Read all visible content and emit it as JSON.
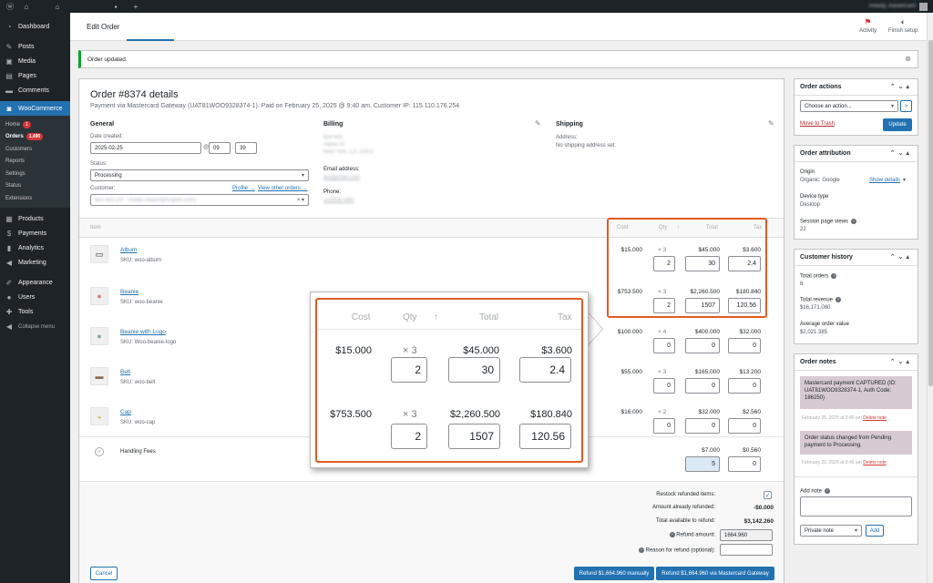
{
  "admin_bar": {
    "greeting": "Howdy, mastercard"
  },
  "sidebar": {
    "items": [
      {
        "label": "Dashboard"
      },
      {
        "label": "Posts"
      },
      {
        "label": "Media"
      },
      {
        "label": "Pages"
      },
      {
        "label": "Comments"
      },
      {
        "label": "WooCommerce"
      }
    ],
    "woo_submenu": [
      {
        "label": "Home",
        "badge": "1"
      },
      {
        "label": "Orders",
        "badge": "1,496"
      },
      {
        "label": "Customers"
      },
      {
        "label": "Reports"
      },
      {
        "label": "Settings"
      },
      {
        "label": "Status"
      },
      {
        "label": "Extensions"
      }
    ],
    "items_after": [
      {
        "label": "Products"
      },
      {
        "label": "Payments"
      },
      {
        "label": "Analytics"
      },
      {
        "label": "Marketing"
      },
      {
        "label": "Appearance"
      },
      {
        "label": "Users"
      },
      {
        "label": "Tools"
      },
      {
        "label": "Collapse menu"
      }
    ]
  },
  "header": {
    "title": "Edit Order",
    "activity": "Activity",
    "finish_setup": "Finish setup"
  },
  "notice": {
    "text": "Order updated."
  },
  "order": {
    "title": "Order #8374 details",
    "subtitle": "Payment via Mastercard Gateway (UAT81WOO9328374-1). Paid on February 25, 2025 @ 9:40 am. Customer IP: 115.110.176.254",
    "general": {
      "heading": "General",
      "date_label": "Date created:",
      "date": "2025-02-25",
      "at": "@",
      "hour": "09",
      "colon": ":",
      "minute": "39",
      "status_label": "Status:",
      "status": "Processing",
      "customer_label": "Customer:",
      "profile_link": "Profile →",
      "other_orders_link": "View other orders →",
      "customer_value": "test test (#4 - mobia.shaikh@fingent.com)"
    },
    "billing": {
      "heading": "Billing",
      "address_lines": [
        "test test",
        "Alpha St",
        "New York, CA 10001"
      ],
      "email_label": "Email address:",
      "email": "test@mail.com",
      "phone_label": "Phone:",
      "phone": "1234567890"
    },
    "shipping": {
      "heading": "Shipping",
      "address_label": "Address:",
      "address": "No shipping address set."
    }
  },
  "items_table": {
    "headers": {
      "item": "Item",
      "cost": "Cost",
      "qty": "Qty",
      "sort": "↑",
      "total": "Total",
      "tax": "Tax"
    },
    "rows": [
      {
        "name": "Album",
        "sku": "SKU: woo-album",
        "icon": "album-icon",
        "cost": "$15.000",
        "qty": "× 3",
        "total": "$45.000",
        "tax": "$3.600",
        "refund_qty": "2",
        "refund_total": "30",
        "refund_tax": "2.4"
      },
      {
        "name": "Beanie",
        "sku": "SKU: woo-beanie",
        "icon": "beanie-icon",
        "cost": "$753.500",
        "qty": "× 3",
        "total": "$2,260.500",
        "tax": "$180.840",
        "refund_qty": "2",
        "refund_total": "1507",
        "refund_tax": "120.56"
      },
      {
        "name": "Beanie with Logo",
        "sku": "SKU: Woo-beanie-logo",
        "icon": "beanie-logo-icon",
        "cost": "$100.000",
        "qty": "× 4",
        "total": "$400.000",
        "tax": "$32.000",
        "refund_qty": "0",
        "refund_total": "0",
        "refund_tax": "0"
      },
      {
        "name": "Belt",
        "sku": "SKU: woo-belt",
        "icon": "belt-icon",
        "cost": "$55.000",
        "qty": "× 3",
        "total": "$165.000",
        "tax": "$13.200",
        "refund_qty": "0",
        "refund_total": "0",
        "refund_tax": "0"
      },
      {
        "name": "Cap",
        "sku": "SKU: woo-cap",
        "icon": "cap-icon",
        "cost": "$16.000",
        "qty": "× 2",
        "total": "$32.000",
        "tax": "$2.560",
        "refund_qty": "0",
        "refund_total": "0",
        "refund_tax": "0"
      }
    ],
    "fee": {
      "name": "Handling Fees",
      "total": "$7.000",
      "tax": "$0.560",
      "refund_total": "5",
      "refund_tax": "0"
    }
  },
  "refund": {
    "restock_label": "Restock refunded items:",
    "already_label": "Amount already refunded:",
    "already_value": "-$0.000",
    "available_label": "Total available to refund:",
    "available_value": "$3,142.260",
    "amount_label": "Refund amount:",
    "amount_value": "1664.960",
    "reason_label": "Reason for refund (optional):",
    "reason_value": "",
    "cancel": "Cancel",
    "manual": "Refund $1,664.960 manually",
    "gateway": "Refund $1,664.960 via Mastercard Gateway"
  },
  "order_actions": {
    "title": "Order actions",
    "select": "Choose an action...",
    "go": ">",
    "trash": "Move to Trash",
    "update": "Update"
  },
  "attribution": {
    "title": "Order attribution",
    "origin_label": "Origin",
    "origin_value": "Organic: Google",
    "show_details": "Show details",
    "device_label": "Device type",
    "device_value": "Desktop",
    "views_label": "Session page views",
    "views_value": "22"
  },
  "customer_history": {
    "title": "Customer history",
    "total_orders_label": "Total orders",
    "total_orders_value": "8",
    "revenue_label": "Total revenue",
    "revenue_value": "$16,171.080",
    "avg_label": "Average order value",
    "avg_value": "$2,021.385"
  },
  "order_notes": {
    "title": "Order notes",
    "notes": [
      {
        "text": "Mastercard payment CAPTURED (ID: UAT81WOO9328374-1, Auth Code: 186250)",
        "meta": "February 25, 2025 at 9:40 am",
        "delete": "Delete note"
      },
      {
        "text": "Order status changed from Pending payment to Processing.",
        "meta": "February 25, 2025 at 9:40 am",
        "delete": "Delete note"
      }
    ],
    "add_label": "Add note",
    "type_value": "Private note",
    "add_button": "Add"
  },
  "colors": {
    "accent": "#2271b1",
    "callout": "#e35b24",
    "sidebar": "#1d2327",
    "notice_green": "#00a32a",
    "note_bg": "#d7cad2"
  }
}
